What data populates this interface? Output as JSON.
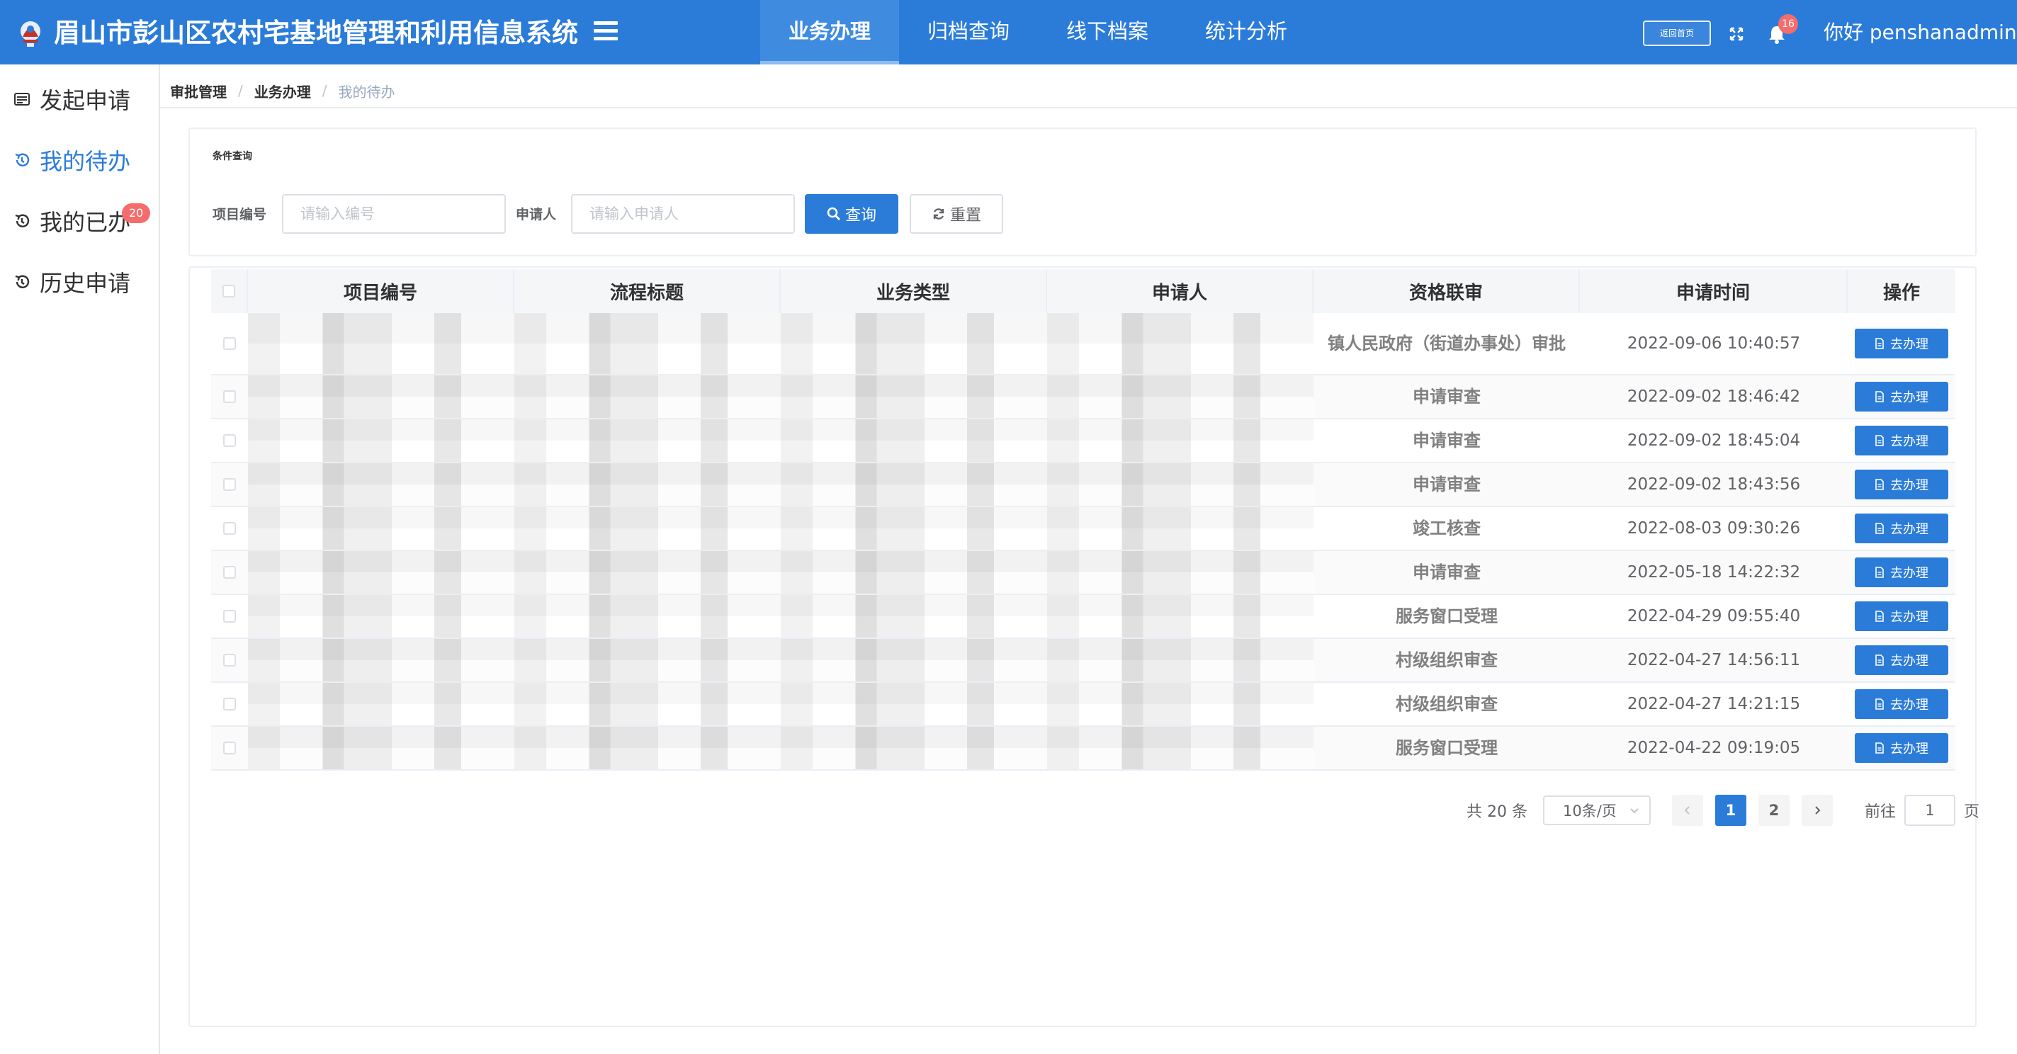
{
  "header": {
    "app_title": "眉山市彭山区农村宅基地管理和利用信息系统",
    "nav": [
      "业务办理",
      "归档查询",
      "线下档案",
      "统计分析"
    ],
    "active_nav": "业务办理",
    "home_button": "返回首页",
    "notification_count": "16",
    "greeting": "你好 penshanadmin"
  },
  "sidebar": {
    "items": [
      {
        "label": "发起申请",
        "icon": "form-icon"
      },
      {
        "label": "我的待办",
        "icon": "history-icon",
        "active": true
      },
      {
        "label": "我的已办",
        "icon": "history-icon",
        "badge": "20"
      },
      {
        "label": "历史申请",
        "icon": "history-icon"
      }
    ]
  },
  "breadcrumb": [
    "审批管理",
    "业务办理",
    "我的待办"
  ],
  "query": {
    "title": "条件查询",
    "project_no_label": "项目编号",
    "project_no_placeholder": "请输入编号",
    "applicant_label": "申请人",
    "applicant_placeholder": "请输入申请人",
    "search_button": "查询",
    "reset_button": "重置"
  },
  "table": {
    "columns": [
      "项目编号",
      "流程标题",
      "业务类型",
      "申请人",
      "资格联审",
      "申请时间",
      "操作"
    ],
    "action_label": "去办理",
    "rows": [
      {
        "status": "镇人民政府（街道办事处）审批",
        "time": "2022-09-06 10:40:57"
      },
      {
        "status": "申请审查",
        "time": "2022-09-02 18:46:42"
      },
      {
        "status": "申请审查",
        "time": "2022-09-02 18:45:04"
      },
      {
        "status": "申请审查",
        "time": "2022-09-02 18:43:56"
      },
      {
        "status": "竣工核查",
        "time": "2022-08-03 09:30:26"
      },
      {
        "status": "申请审查",
        "time": "2022-05-18 14:22:32"
      },
      {
        "status": "服务窗口受理",
        "time": "2022-04-29 09:55:40"
      },
      {
        "status": "村级组织审查",
        "time": "2022-04-27 14:56:11"
      },
      {
        "status": "村级组织审查",
        "time": "2022-04-27 14:21:15"
      },
      {
        "status": "服务窗口受理",
        "time": "2022-04-22 09:19:05"
      }
    ]
  },
  "pagination": {
    "total": "共 20 条",
    "page_size": "10条/页",
    "pages": [
      "1",
      "2"
    ],
    "current_page": "1",
    "goto_prefix": "前往",
    "goto_value": "1",
    "goto_suffix": "页"
  },
  "colors": {
    "primary": "#2b7cd9",
    "badge": "#f56c6c"
  }
}
